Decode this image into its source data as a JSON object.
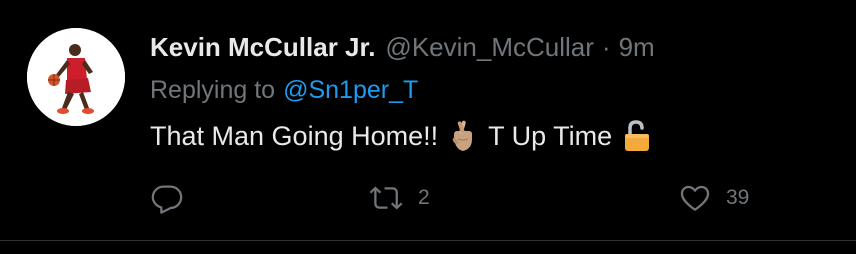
{
  "tweet": {
    "author_name": "Kevin McCullar Jr.",
    "author_handle": "@Kevin_McCullar",
    "separator": "·",
    "time": "9m",
    "reply_prefix": "Replying to",
    "reply_to": "@Sn1per_T",
    "text_part1": "That Man Going Home!!",
    "text_part2": "T Up Time",
    "emojis": [
      "crossed-fingers-icon",
      "unlocked-padlock-icon"
    ]
  },
  "actions": {
    "reply_count": "",
    "retweet_count": "2",
    "like_count": "39"
  },
  "colors": {
    "background": "#000000",
    "primary_text": "#e7e9ea",
    "secondary_text": "#71767b",
    "link": "#1d9bf0",
    "divider": "#2f3336",
    "padlock": "#f4a93c"
  }
}
